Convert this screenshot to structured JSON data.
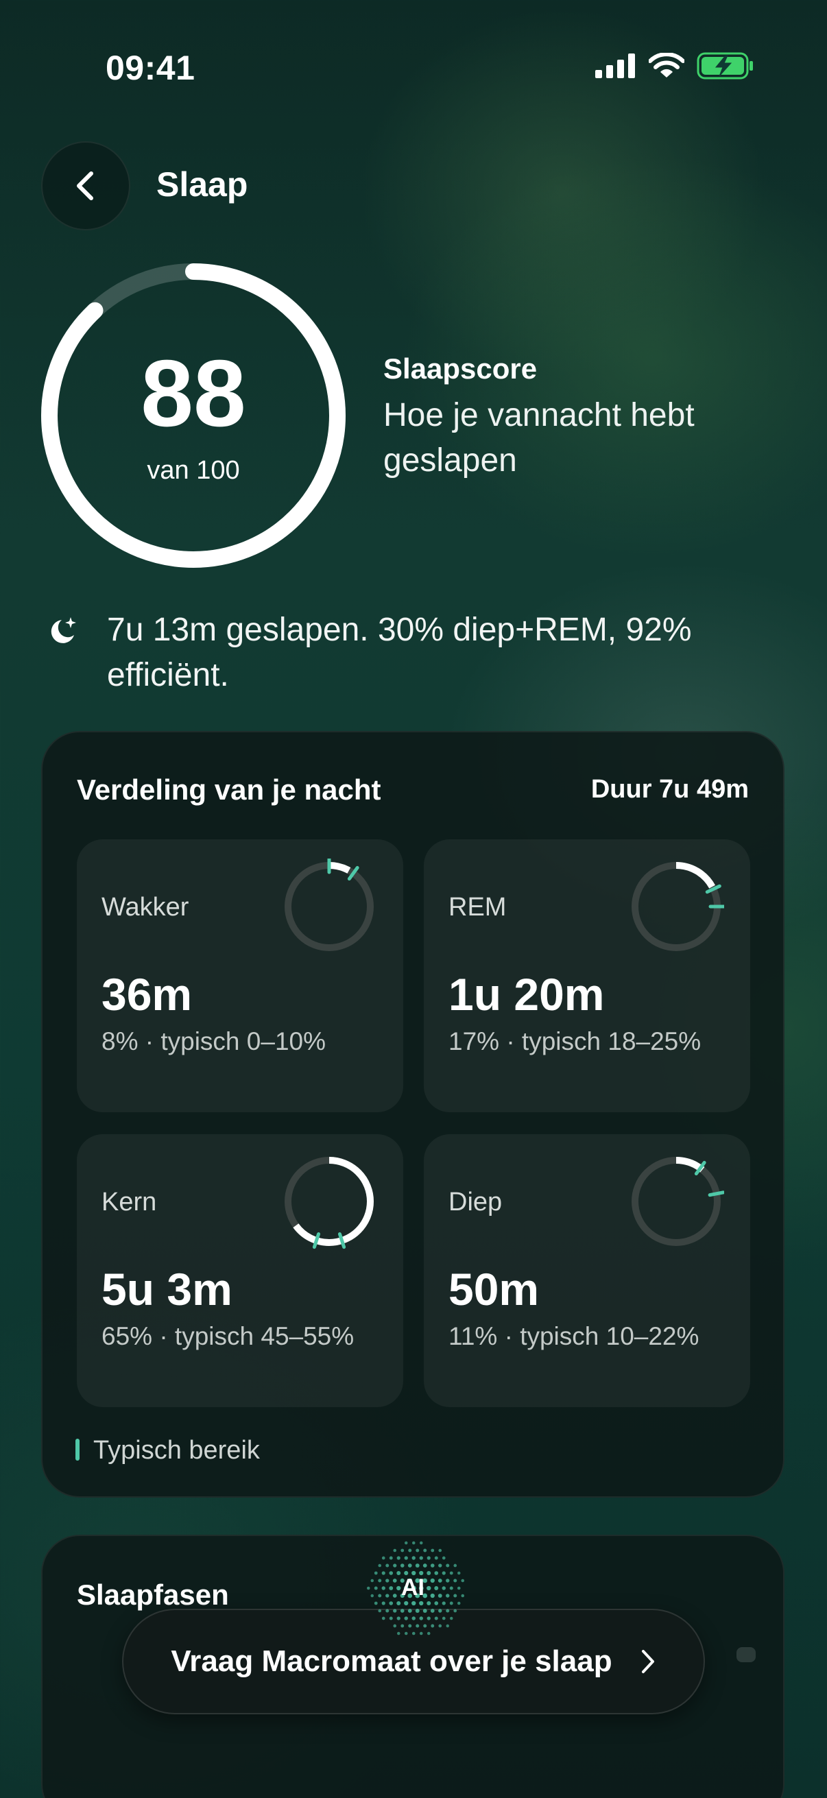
{
  "status_bar": {
    "time": "09:41"
  },
  "header": {
    "title": "Slaap"
  },
  "score": {
    "value": "88",
    "of_label": "van 100",
    "fraction": 0.88,
    "label": "Slaapscore",
    "description": "Hoe je vannacht hebt geslapen"
  },
  "summary": {
    "text": "7u 13m geslapen. 30% diep+REM, 92% efficiënt."
  },
  "distribution": {
    "title": "Verdeling van je nacht",
    "duration": "Duur 7u 49m",
    "stages": [
      {
        "name": "Wakker",
        "value": "36m",
        "note": "8% · typisch 0–10%",
        "percent": 8,
        "typical": [
          0,
          10
        ]
      },
      {
        "name": "REM",
        "value": "1u 20m",
        "note": "17% · typisch 18–25%",
        "percent": 17,
        "typical": [
          18,
          25
        ]
      },
      {
        "name": "Kern",
        "value": "5u 3m",
        "note": "65% · typisch 45–55%",
        "percent": 65,
        "typical": [
          45,
          55
        ]
      },
      {
        "name": "Diep",
        "value": "50m",
        "note": "11% · typisch 10–22%",
        "percent": 11,
        "typical": [
          10,
          22
        ]
      }
    ],
    "legend": "Typisch bereik"
  },
  "phases": {
    "title": "Slaapfasen"
  },
  "ask": {
    "ai_badge": "AI",
    "label": "Vraag Macromaat over je slaap"
  },
  "colors": {
    "accent": "#4fc8a8",
    "ring_track": "#3a4341",
    "ring_fill": "#ffffff"
  }
}
